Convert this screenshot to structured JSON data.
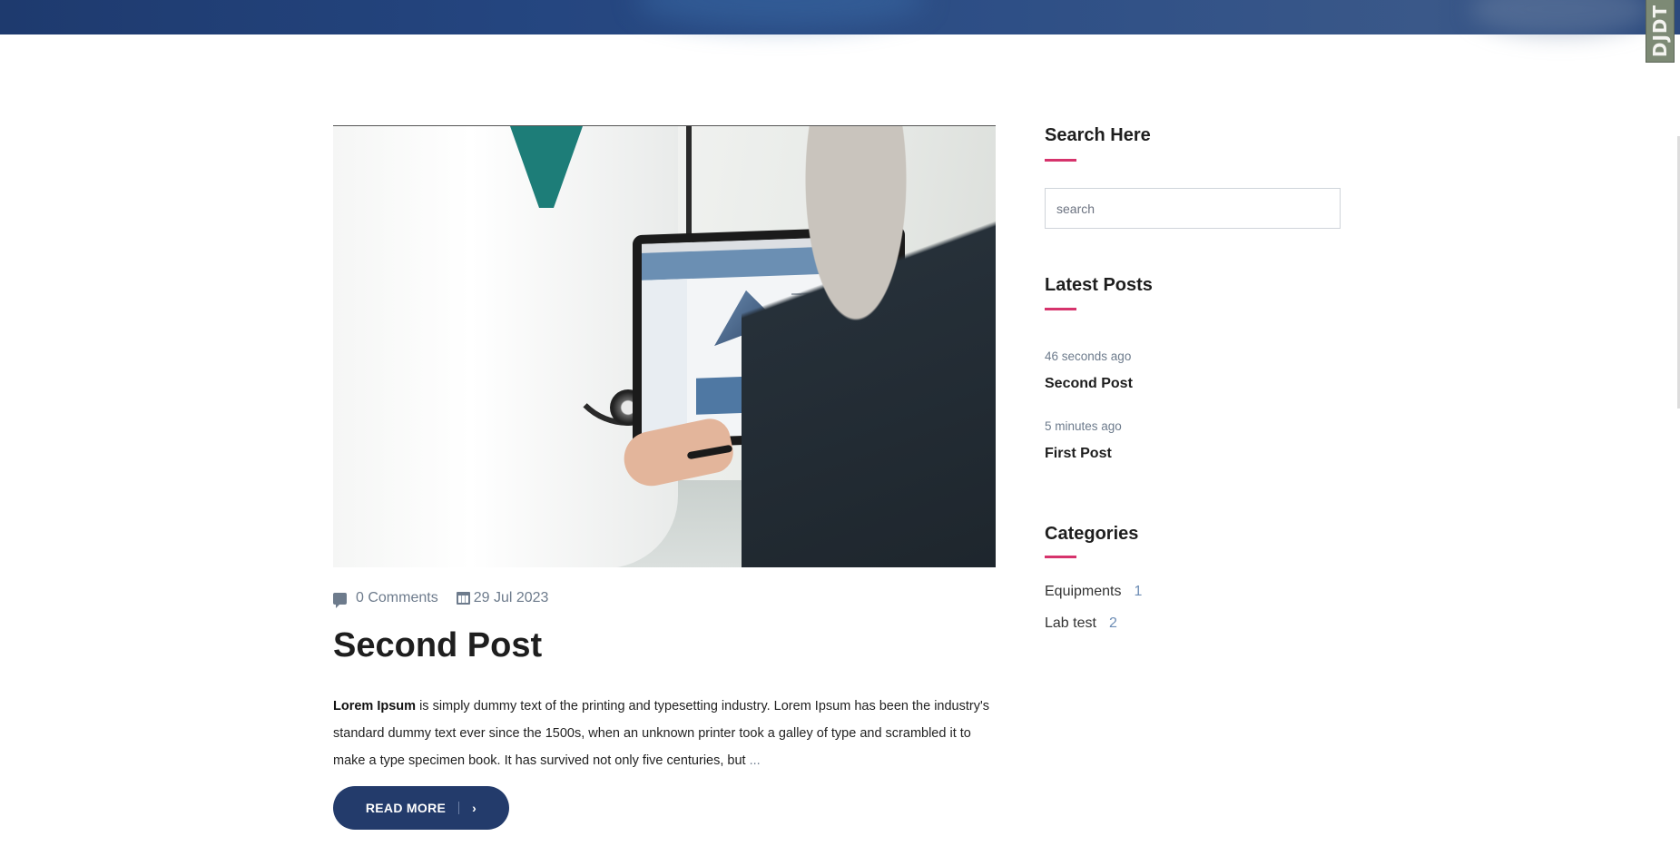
{
  "debug_toolbar": {
    "label": "DJDT"
  },
  "post": {
    "meta": {
      "comments": "0 Comments",
      "date": "29 Jul 2023"
    },
    "title": "Second Post",
    "excerpt_bold": "Lorem Ipsum",
    "excerpt_text": " is simply dummy text of the printing and typesetting industry. Lorem Ipsum has been the industry's standard dummy text ever since the 1500s, when an unknown printer took a galley of type and scrambled it to make a type specimen book. It has survived not only five centuries, but ",
    "excerpt_ellipsis": "...",
    "read_more_label": "READ MORE",
    "read_more_icon": "chevron-right-icon"
  },
  "sidebar": {
    "search": {
      "title": "Search Here",
      "placeholder": "search"
    },
    "latest": {
      "title": "Latest Posts",
      "items": [
        {
          "time": "46 seconds ago",
          "title": "Second Post"
        },
        {
          "time": "5 minutes ago",
          "title": "First Post"
        }
      ]
    },
    "categories": {
      "title": "Categories",
      "items": [
        {
          "name": "Equipments",
          "count": "1"
        },
        {
          "name": "Lab test",
          "count": "2"
        }
      ]
    }
  },
  "colors": {
    "accent": "#d6336c",
    "button": "#233b6b",
    "meta": "#6d7b8c",
    "banner": "#24457f"
  }
}
